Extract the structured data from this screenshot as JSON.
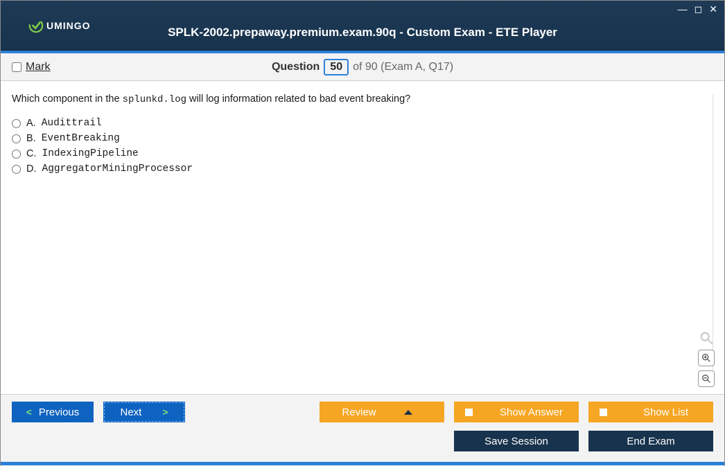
{
  "header": {
    "logo_text": "UMINGO",
    "title": "SPLK-2002.prepaway.premium.exam.90q - Custom Exam - ETE Player"
  },
  "qbar": {
    "mark_label": "Mark",
    "question_label": "Question",
    "current_number": "50",
    "of_text": "of 90 (Exam A, Q17)"
  },
  "question": {
    "prefix": "Which component in the ",
    "mono": "splunkd.log",
    "suffix": " will log information related to bad event breaking?"
  },
  "options": [
    {
      "letter": "A.",
      "text": "Audittrail"
    },
    {
      "letter": "B.",
      "text": "EventBreaking"
    },
    {
      "letter": "C.",
      "text": "IndexingPipeline"
    },
    {
      "letter": "D.",
      "text": "AggregatorMiningProcessor"
    }
  ],
  "footer": {
    "previous": "Previous",
    "next": "Next",
    "review": "Review",
    "show_answer": "Show Answer",
    "show_list": "Show List",
    "save_session": "Save Session",
    "end_exam": "End Exam"
  }
}
